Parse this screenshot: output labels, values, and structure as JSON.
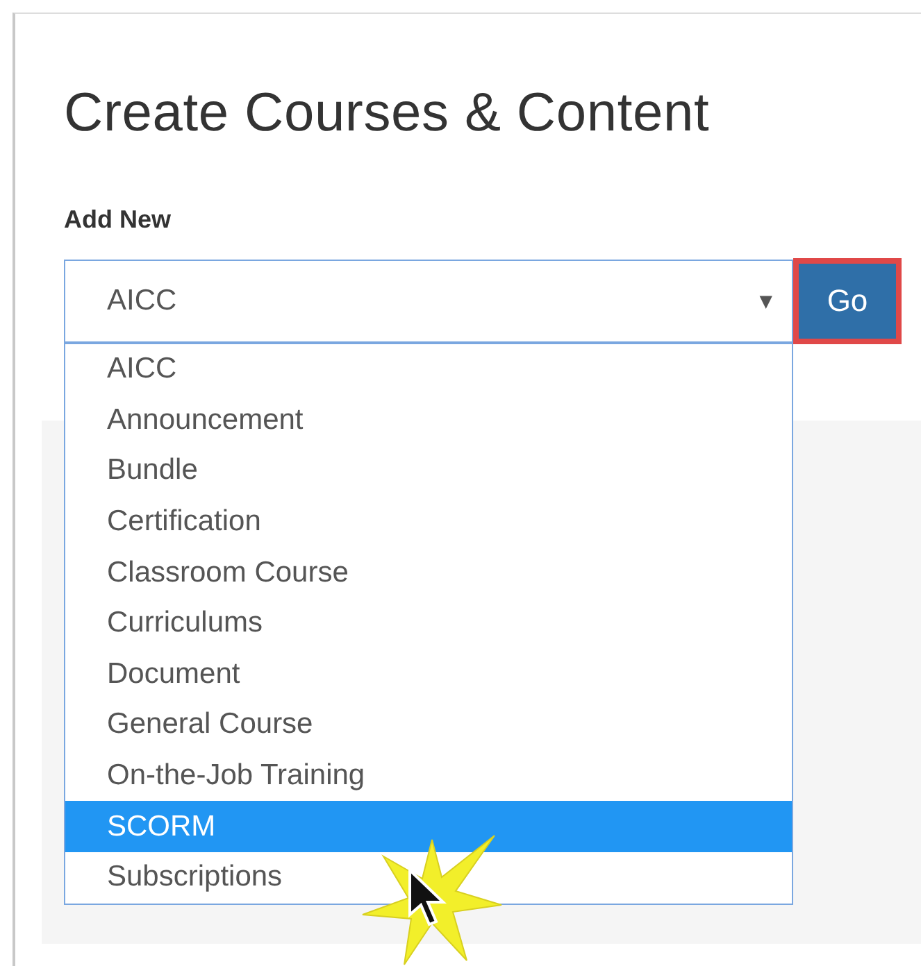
{
  "title": "Create Courses & Content",
  "add_new": {
    "label": "Add New",
    "value": "AICC",
    "caret": "▼",
    "button": "Go",
    "button_highlighted": true
  },
  "options": [
    {
      "label": "AICC",
      "selected": false
    },
    {
      "label": "Announcement",
      "selected": false
    },
    {
      "label": "Bundle",
      "selected": false
    },
    {
      "label": "Certification",
      "selected": false
    },
    {
      "label": "Classroom Course",
      "selected": false
    },
    {
      "label": "Curriculums",
      "selected": false
    },
    {
      "label": "Document",
      "selected": false
    },
    {
      "label": "General Course",
      "selected": false
    },
    {
      "label": "On-the-Job Training",
      "selected": false
    },
    {
      "label": "SCORM",
      "selected": true
    },
    {
      "label": "Subscriptions",
      "selected": false
    }
  ]
}
